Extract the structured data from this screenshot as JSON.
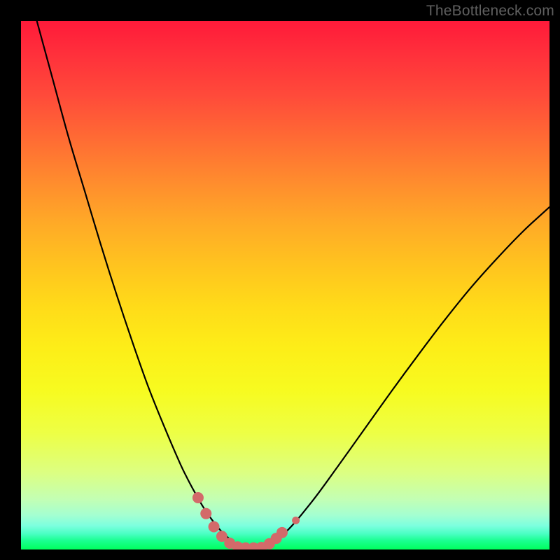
{
  "watermark": {
    "text": "TheBottleneck.com"
  },
  "chart_data": {
    "type": "line",
    "title": "",
    "xlabel": "",
    "ylabel": "",
    "xlim": [
      0,
      100
    ],
    "ylim": [
      0,
      100
    ],
    "grid": false,
    "background_gradient": {
      "direction": "vertical",
      "stops": [
        {
          "pos": 0.0,
          "color": "#ff1a3a"
        },
        {
          "pos": 0.5,
          "color": "#ffdb19"
        },
        {
          "pos": 0.78,
          "color": "#edff45"
        },
        {
          "pos": 1.0,
          "color": "#00ff5e"
        }
      ]
    },
    "series": [
      {
        "name": "bottleneck-curve",
        "color": "#000000",
        "x": [
          3,
          6,
          9,
          12,
          15,
          18,
          21,
          24,
          27,
          30,
          31.5,
          33,
          34.5,
          36,
          37.5,
          39,
          40.5,
          42,
          46,
          50,
          55,
          60,
          65,
          70,
          75,
          80,
          85,
          90,
          95,
          100
        ],
        "y": [
          100,
          89,
          78,
          68,
          58,
          48.5,
          39.5,
          31,
          23.5,
          16.5,
          13.4,
          10.6,
          8.0,
          5.8,
          3.9,
          2.4,
          1.2,
          0.4,
          0.4,
          3.2,
          9.0,
          15.8,
          22.8,
          29.8,
          36.6,
          43.2,
          49.4,
          55.0,
          60.2,
          64.8
        ]
      }
    ],
    "markers": {
      "name": "highlight-dots",
      "color": "#d36a6a",
      "radius_large": 8,
      "radius_small": 5.5,
      "points": [
        {
          "x": 33.5,
          "y": 9.8,
          "r": "large"
        },
        {
          "x": 35.0,
          "y": 6.8,
          "r": "large"
        },
        {
          "x": 36.5,
          "y": 4.3,
          "r": "large"
        },
        {
          "x": 38.0,
          "y": 2.5,
          "r": "large"
        },
        {
          "x": 39.5,
          "y": 1.2,
          "r": "large"
        },
        {
          "x": 41.0,
          "y": 0.5,
          "r": "large"
        },
        {
          "x": 42.5,
          "y": 0.3,
          "r": "large"
        },
        {
          "x": 44.0,
          "y": 0.3,
          "r": "large"
        },
        {
          "x": 45.5,
          "y": 0.4,
          "r": "large"
        },
        {
          "x": 47.0,
          "y": 1.1,
          "r": "large"
        },
        {
          "x": 48.3,
          "y": 2.1,
          "r": "large"
        },
        {
          "x": 49.4,
          "y": 3.2,
          "r": "large"
        },
        {
          "x": 52.0,
          "y": 5.5,
          "r": "small"
        }
      ]
    }
  }
}
